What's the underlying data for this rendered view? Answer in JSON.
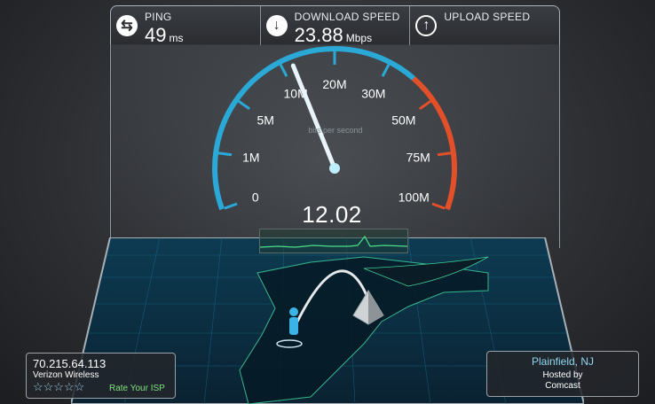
{
  "ping": {
    "label": "PING",
    "value": "49",
    "unit": "ms",
    "icon": "ping-arrows-icon"
  },
  "download": {
    "label": "DOWNLOAD SPEED",
    "value": "23.88",
    "unit": "Mbps",
    "icon": "download-arrow-icon"
  },
  "upload": {
    "label": "UPLOAD SPEED",
    "value": "",
    "unit": "",
    "icon": "upload-arrow-icon"
  },
  "gauge": {
    "ticks": [
      "0",
      "1M",
      "5M",
      "10M",
      "20M",
      "30M",
      "50M",
      "75M",
      "100M"
    ],
    "unit_label": "bits per second",
    "current": "12.02",
    "needle_value_mbps": 12.02
  },
  "client": {
    "ip": "70.215.64.113",
    "isp": "Verizon Wireless",
    "stars": "☆☆☆☆☆",
    "rate_label": "Rate Your ISP"
  },
  "server": {
    "city": "Plainfield, NJ",
    "hosted_by_label": "Hosted by",
    "host": "Comcast"
  },
  "colors": {
    "gauge_blue": "#2aa9d6",
    "gauge_red": "#e2502a",
    "needle": "#e8f4fa",
    "map_grid": "#1b7ea6"
  }
}
